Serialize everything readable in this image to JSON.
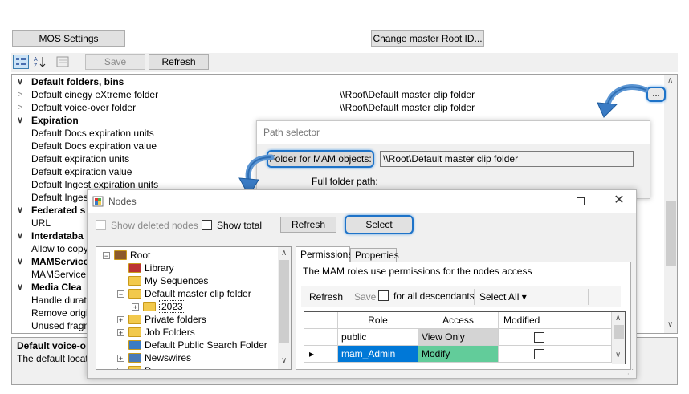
{
  "top_buttons": {
    "mos_settings": "MOS Settings",
    "change_root": "Change master Root ID..."
  },
  "toolbar": {
    "save": "Save",
    "refresh": "Refresh"
  },
  "properties": {
    "rows": [
      {
        "type": "cat",
        "label": "Default folders, bins",
        "chev": "∨"
      },
      {
        "type": "item",
        "label": "Default cinegy eXtreme folder",
        "value": "\\\\Root\\Default master clip folder",
        "chev": ">"
      },
      {
        "type": "item",
        "label": "Default voice-over folder",
        "value": "\\\\Root\\Default master clip folder",
        "chev": ">"
      },
      {
        "type": "cat",
        "label": "Expiration",
        "chev": "∨"
      },
      {
        "type": "item",
        "label": "Default Docs expiration units",
        "value": ""
      },
      {
        "type": "item",
        "label": "Default Docs expiration value",
        "value": ""
      },
      {
        "type": "item",
        "label": "Default expiration units",
        "value": ""
      },
      {
        "type": "item",
        "label": "Default expiration value",
        "value": ""
      },
      {
        "type": "item",
        "label": "Default Ingest expiration units",
        "value": ""
      },
      {
        "type": "item",
        "label": "Default Ingest",
        "value": ""
      },
      {
        "type": "cat",
        "label": "Federated s",
        "chev": "∨"
      },
      {
        "type": "item",
        "label": "URL",
        "value": ""
      },
      {
        "type": "cat",
        "label": "Interdataba",
        "chev": "∨"
      },
      {
        "type": "item",
        "label": "Allow to copy",
        "value": ""
      },
      {
        "type": "cat",
        "label": "MAMService",
        "chev": "∨"
      },
      {
        "type": "item",
        "label": "MAMService",
        "value": ""
      },
      {
        "type": "cat",
        "label": "Media Clea",
        "chev": "∨"
      },
      {
        "type": "item",
        "label": "Handle duratio",
        "value": ""
      },
      {
        "type": "item",
        "label": "Remove origin",
        "value": ""
      },
      {
        "type": "item",
        "label": "Unused fragm",
        "value": ""
      }
    ],
    "ellipsis": "...",
    "description_title": "Default voice-o",
    "description_text": "The default locatio"
  },
  "path_selector": {
    "title": "Path selector",
    "folder_label": "Folder for MAM objects:",
    "folder_value": "\\\\Root\\Default master clip folder",
    "full_path_label": "Full folder path:"
  },
  "nodes": {
    "title": "Nodes",
    "show_deleted": "Show deleted nodes",
    "show_total": "Show total",
    "refresh": "Refresh",
    "select": "Select",
    "tree": [
      {
        "label": "Root",
        "level": 0,
        "icon": "root",
        "expander": "−"
      },
      {
        "label": "Library",
        "level": 1,
        "icon": "library"
      },
      {
        "label": "My Sequences",
        "level": 1,
        "icon": "folder"
      },
      {
        "label": "Default master clip folder",
        "level": 1,
        "icon": "folder",
        "expander": "−"
      },
      {
        "label": "2023",
        "level": 2,
        "icon": "folder",
        "expander": "+",
        "selected": true
      },
      {
        "label": "Private folders",
        "level": 1,
        "icon": "folder",
        "expander": "+"
      },
      {
        "label": "Job Folders",
        "level": 1,
        "icon": "folder",
        "expander": "+"
      },
      {
        "label": "Default Public Search Folder",
        "level": 1,
        "icon": "search"
      },
      {
        "label": "Newswires",
        "level": 1,
        "icon": "newswires",
        "expander": "+"
      },
      {
        "label": "P",
        "level": 1,
        "icon": "folder",
        "expander": "+"
      }
    ],
    "tabs": [
      "Permissions",
      "Properties"
    ],
    "permissions_note": "The MAM roles use permissions for the nodes access",
    "perm_toolbar": {
      "refresh": "Refresh",
      "save": "Save",
      "for_all": "for all descendants",
      "select_all": "Select All ▾"
    },
    "grid_headers": [
      "Role",
      "Access",
      "Modified"
    ],
    "grid_rows": [
      {
        "role": "public",
        "access": "View Only",
        "access_color": "#d4d4d4"
      },
      {
        "role": "mam_Admin",
        "access": "Modify",
        "access_color": "#62cc9a",
        "selected": true
      }
    ]
  },
  "colors": {
    "accent": "#1e73c8",
    "selection": "#0078d7",
    "modify": "#62cc9a"
  }
}
